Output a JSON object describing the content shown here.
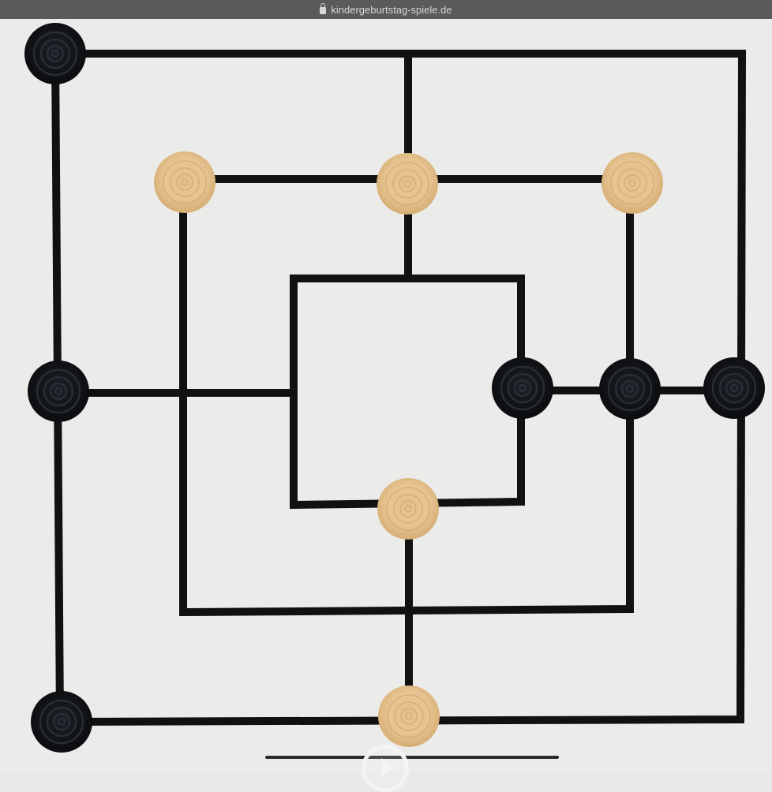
{
  "browser": {
    "url_text": "kindergeburtstag-spiele.de"
  },
  "game": {
    "name": "Nine Men's Morris board",
    "colors": {
      "board_background": "#ebebea",
      "line": "#111111",
      "black_piece": "#121418",
      "light_piece": "#e6c28e"
    },
    "pieces": [
      {
        "player": "black",
        "position": "outer-top-left"
      },
      {
        "player": "black",
        "position": "outer-middle-left"
      },
      {
        "player": "black",
        "position": "outer-bottom-left"
      },
      {
        "player": "black",
        "position": "outer-middle-right"
      },
      {
        "player": "black",
        "position": "middle-middle-right"
      },
      {
        "player": "black",
        "position": "inner-middle-right"
      },
      {
        "player": "light",
        "position": "middle-top-left"
      },
      {
        "player": "light",
        "position": "middle-top-center"
      },
      {
        "player": "light",
        "position": "middle-top-right"
      },
      {
        "player": "light",
        "position": "inner-bottom-center"
      },
      {
        "player": "light",
        "position": "outer-bottom-center"
      }
    ]
  },
  "icons": {
    "lock": "lock-icon",
    "play": "play-icon",
    "home": "home-indicator"
  }
}
